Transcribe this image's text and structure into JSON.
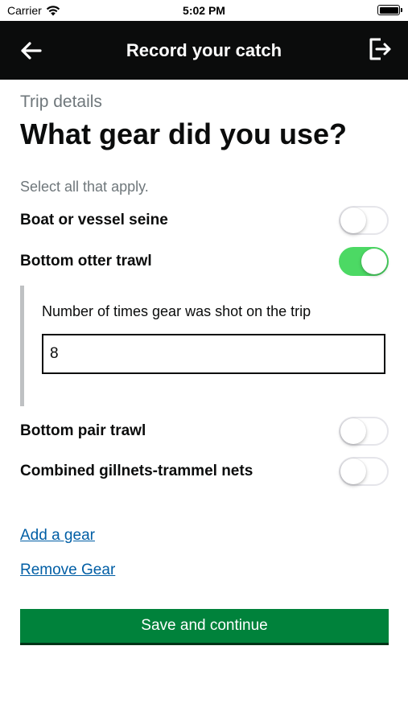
{
  "status_bar": {
    "carrier": "Carrier",
    "time": "5:02 PM"
  },
  "header": {
    "title": "Record your catch",
    "back_icon": "arrow-left-icon",
    "exit_icon": "sign-out-icon",
    "background": "#0b0c0c"
  },
  "page": {
    "caption": "Trip details",
    "heading": "What gear did you use?",
    "hint": "Select all that apply."
  },
  "gear_options": [
    {
      "label": "Boat or vessel seine",
      "checked": false
    },
    {
      "label": "Bottom otter trawl",
      "checked": true
    },
    {
      "label": "Bottom pair trawl",
      "checked": false
    },
    {
      "label": "Combined gillnets-trammel nets",
      "checked": false
    }
  ],
  "conditional": {
    "label": "Number of times gear was shot on the trip",
    "value": "8"
  },
  "links": {
    "add_gear": "Add a gear",
    "remove_gear": "Remove Gear"
  },
  "primary_button": {
    "label": "Save and continue",
    "color": "#00823b"
  },
  "colors": {
    "toggle_on": "#4cd964",
    "link": "#005ea5",
    "secondary_text": "#6f777b"
  }
}
